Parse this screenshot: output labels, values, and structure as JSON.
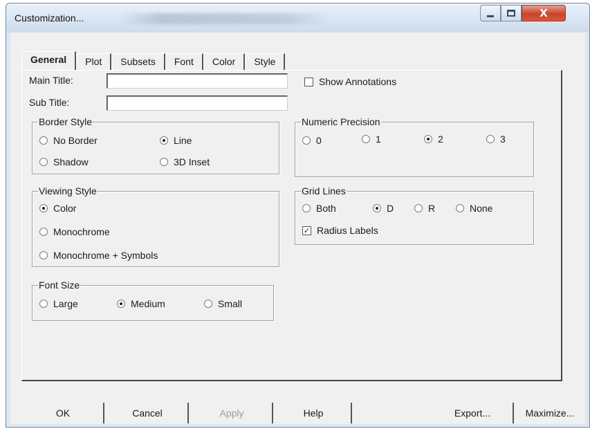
{
  "window": {
    "title": "Customization...",
    "close_glyph": "X"
  },
  "tabs": [
    {
      "label": "General",
      "active": true
    },
    {
      "label": "Plot"
    },
    {
      "label": "Subsets"
    },
    {
      "label": "Font"
    },
    {
      "label": "Color"
    },
    {
      "label": "Style"
    }
  ],
  "fields": {
    "main_title_label": "Main Title:",
    "main_title_value": "",
    "sub_title_label": "Sub Title:",
    "sub_title_value": ""
  },
  "show_annotations": {
    "label": "Show Annotations",
    "checked": false
  },
  "border_style": {
    "title": "Border Style",
    "options": [
      "No Border",
      "Line",
      "Shadow",
      "3D Inset"
    ],
    "selected": "Line"
  },
  "numeric_precision": {
    "title": "Numeric Precision",
    "options": [
      "0",
      "1",
      "2",
      "3"
    ],
    "selected": "2"
  },
  "viewing_style": {
    "title": "Viewing Style",
    "options": [
      "Color",
      "Monochrome",
      "Monochrome + Symbols"
    ],
    "selected": "Color"
  },
  "grid_lines": {
    "title": "Grid Lines",
    "options": [
      "Both",
      "D",
      "R",
      "None"
    ],
    "selected": "D",
    "radius_labels": {
      "label": "Radius Labels",
      "checked": true,
      "mark": "✓"
    }
  },
  "font_size": {
    "title": "Font Size",
    "options": [
      "Large",
      "Medium",
      "Small"
    ],
    "selected": "Medium"
  },
  "buttons": {
    "ok": "OK",
    "cancel": "Cancel",
    "apply": "Apply",
    "help": "Help",
    "export": "Export...",
    "maximize": "Maximize..."
  }
}
